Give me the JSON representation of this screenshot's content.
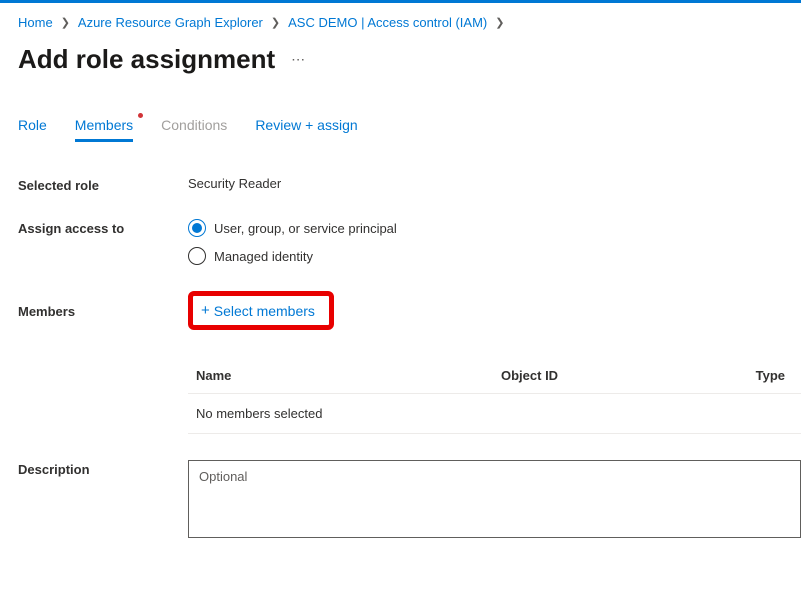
{
  "breadcrumb": {
    "items": [
      "Home",
      "Azure Resource Graph Explorer",
      "ASC DEMO | Access control (IAM)"
    ]
  },
  "page": {
    "title": "Add role assignment"
  },
  "tabs": {
    "role": "Role",
    "members": "Members",
    "conditions": "Conditions",
    "review": "Review + assign"
  },
  "form": {
    "selectedRoleLabel": "Selected role",
    "selectedRoleValue": "Security Reader",
    "assignAccessLabel": "Assign access to",
    "radioUser": "User, group, or service principal",
    "radioManaged": "Managed identity",
    "membersLabel": "Members",
    "selectMembersLabel": "Select members",
    "descriptionLabel": "Description",
    "descriptionPlaceholder": "Optional"
  },
  "membersTable": {
    "colName": "Name",
    "colObjectId": "Object ID",
    "colType": "Type",
    "emptyText": "No members selected"
  }
}
